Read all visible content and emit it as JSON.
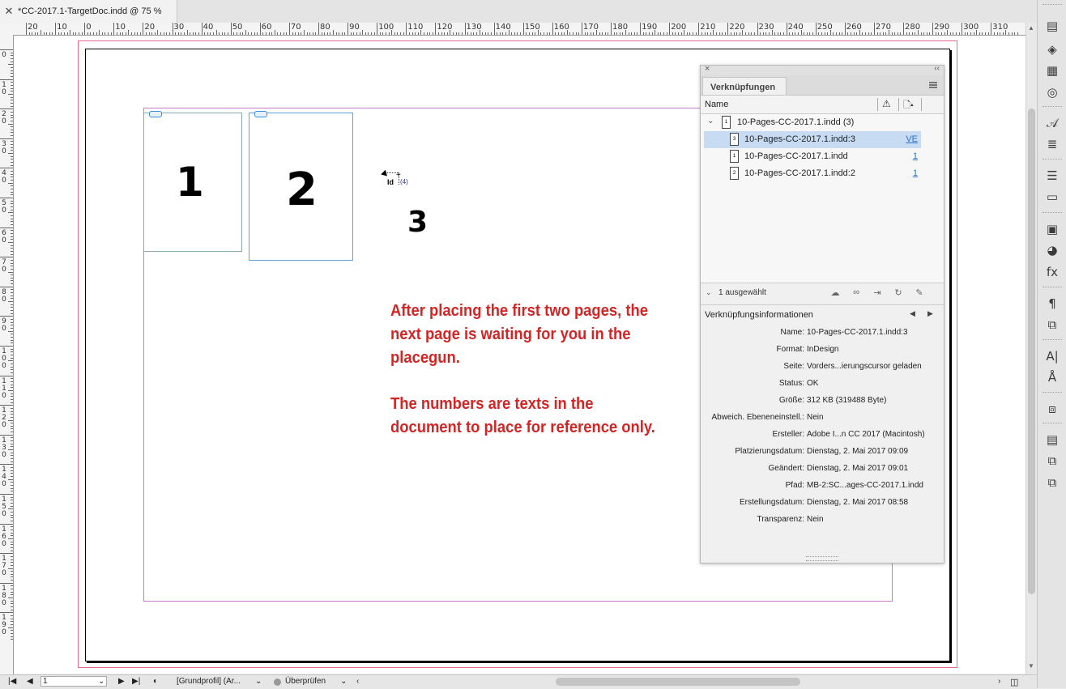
{
  "document": {
    "tab_title": "*CC-2017.1-TargetDoc.indd @ 75 %",
    "close_glyph": "✕"
  },
  "ruler": {
    "top_labels": [
      "20",
      "10",
      "0",
      "10",
      "20",
      "30",
      "40",
      "50",
      "60",
      "70",
      "80",
      "90",
      "100",
      "110",
      "120",
      "130",
      "140",
      "150",
      "160",
      "170",
      "180",
      "190",
      "200",
      "210",
      "220",
      "230",
      "240",
      "250",
      "260",
      "270",
      "280",
      "290",
      "300",
      "310"
    ],
    "left_labels": [
      "0",
      "10",
      "20",
      "30",
      "40",
      "50",
      "60",
      "70",
      "80",
      "90",
      "100",
      "110",
      "120",
      "130",
      "140",
      "150",
      "160",
      "170",
      "180",
      "190"
    ]
  },
  "canvas": {
    "num1": "1",
    "num2": "2",
    "num3": "3",
    "placegun": {
      "id": "Id",
      "plus": "+",
      "count": "(4)"
    },
    "note1": "After placing the first two pages, the next page is waiting for you in the placegun.",
    "note2": "The numbers are texts in the document to place for reference only."
  },
  "panel": {
    "close_glyph": "×",
    "collapse_glyph": "‹‹",
    "tab": "Verknüpfungen",
    "col_name": "Name",
    "col_warn_glyph": "⚠",
    "col_page_glyph": "🗋▴",
    "links": [
      {
        "chev": "⌄",
        "page_icon": "1",
        "name": "10-Pages-CC-2017.1.indd (3)",
        "page": "",
        "selected": false
      },
      {
        "page_icon": "3",
        "name": "10-Pages-CC-2017.1.indd:3",
        "page": "VE",
        "selected": true
      },
      {
        "page_icon": "1",
        "name": "10-Pages-CC-2017.1.indd",
        "page": "1",
        "selected": false
      },
      {
        "page_icon": "2",
        "name": "10-Pages-CC-2017.1.indd:2",
        "page": "1",
        "selected": false
      }
    ],
    "selection_chev": "⌄",
    "selection_text": "1 ausgewählt",
    "toolbar_glyphs": {
      "cloud": "☁",
      "relink": "∞",
      "goto": "⇥",
      "update": "↻",
      "edit": "✎"
    },
    "info_title": "Verknüpfungsinformationen",
    "info_prev": "◀",
    "info_next": "▶",
    "info": [
      {
        "k": "Name:",
        "v": "10-Pages-CC-2017.1.indd:3"
      },
      {
        "k": "Format:",
        "v": "InDesign"
      },
      {
        "k": "Seite:",
        "v": "Vorders...ierungscursor geladen"
      },
      {
        "k": "Status:",
        "v": "OK"
      },
      {
        "k": "Größe:",
        "v": "312 KB (319488 Byte)"
      },
      {
        "k": "Abweich. Ebeneneinstell.:",
        "v": "Nein"
      },
      {
        "k": "Ersteller:",
        "v": "Adobe I...n CC 2017 (Macintosh)"
      },
      {
        "k": "Platzierungsdatum:",
        "v": "Dienstag, 2. Mai 2017 09:09"
      },
      {
        "k": "Geändert:",
        "v": "Dienstag, 2. Mai 2017 09:01"
      },
      {
        "k": "Pfad:",
        "v": "MB-2:SC...ages-CC-2017.1.indd"
      },
      {
        "k": "Erstellungsdatum:",
        "v": "Dienstag, 2. Mai 2017 08:58"
      },
      {
        "k": "Transparenz:",
        "v": "Nein"
      }
    ]
  },
  "tools": [
    {
      "name": "pages-icon",
      "glyph": "▤"
    },
    {
      "name": "layers-icon",
      "glyph": "◈"
    },
    {
      "name": "swatches-icon",
      "glyph": "▦"
    },
    {
      "name": "cc-libraries-icon",
      "glyph": "◎"
    },
    {
      "name": "character-styles-icon",
      "glyph": "𝒜"
    },
    {
      "name": "paragraph-styles-icon",
      "glyph": "≣"
    },
    {
      "name": "stroke-icon",
      "glyph": "☰"
    },
    {
      "name": "gradient-icon",
      "glyph": "▭"
    },
    {
      "name": "article-icon",
      "glyph": "▣"
    },
    {
      "name": "color-icon",
      "glyph": "◕"
    },
    {
      "name": "effects-icon",
      "glyph": "fx"
    },
    {
      "name": "paragraph-icon",
      "glyph": "¶"
    },
    {
      "name": "text-wrap-icon",
      "glyph": "⧉"
    },
    {
      "name": "character-icon",
      "glyph": "A|"
    },
    {
      "name": "glyphs-icon",
      "glyph": "Å"
    },
    {
      "name": "transform-icon",
      "glyph": "⧈"
    },
    {
      "name": "table-icon",
      "glyph": "▤"
    },
    {
      "name": "object-styles-icon",
      "glyph": "⧉"
    },
    {
      "name": "cell-styles-icon",
      "glyph": "⧉"
    }
  ],
  "statusbar": {
    "first_page": "|◀",
    "prev_page": "◀",
    "page": "1",
    "page_dropdown": "⌄",
    "next_page": "▶",
    "last_page": "▶|",
    "profile_glyph": "◐",
    "profile": "[Grundprofil] (Ar...",
    "profile_dropdown": "⌄",
    "preflight": "Überprüfen",
    "preflight_dropdown": "⌄",
    "scroll_left": "‹",
    "scroll_right": "›"
  },
  "colors": {
    "note_red": "#d42424",
    "selection_blue": "#c7dcf3",
    "frame_blue": "#5aa2e0",
    "bleed_pink": "#e56b8a",
    "margin_purple": "#c77ec7"
  }
}
